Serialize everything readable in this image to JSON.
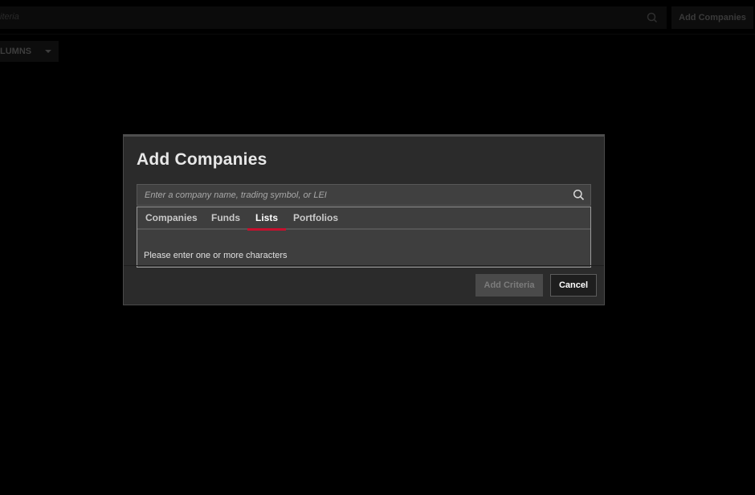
{
  "background": {
    "search_placeholder": "iteria",
    "add_companies_label": "Add Companies",
    "columns_label": "LUMNS"
  },
  "modal": {
    "title": "Add Companies",
    "search": {
      "placeholder": "Enter a company name, trading symbol, or LEI",
      "value": ""
    },
    "tabs": [
      {
        "label": "Companies",
        "active": false
      },
      {
        "label": "Funds",
        "active": false
      },
      {
        "label": "Lists",
        "active": true
      },
      {
        "label": "Portfolios",
        "active": false
      }
    ],
    "empty_message": "Please enter one or more characters",
    "buttons": {
      "add_criteria": "Add Criteria",
      "cancel": "Cancel"
    }
  },
  "colors": {
    "accent": "#c8102e",
    "background": "#000000",
    "modal_bg": "#2b2b2b"
  },
  "icons": {
    "search": "search-icon",
    "caret": "chevron-down-icon"
  }
}
